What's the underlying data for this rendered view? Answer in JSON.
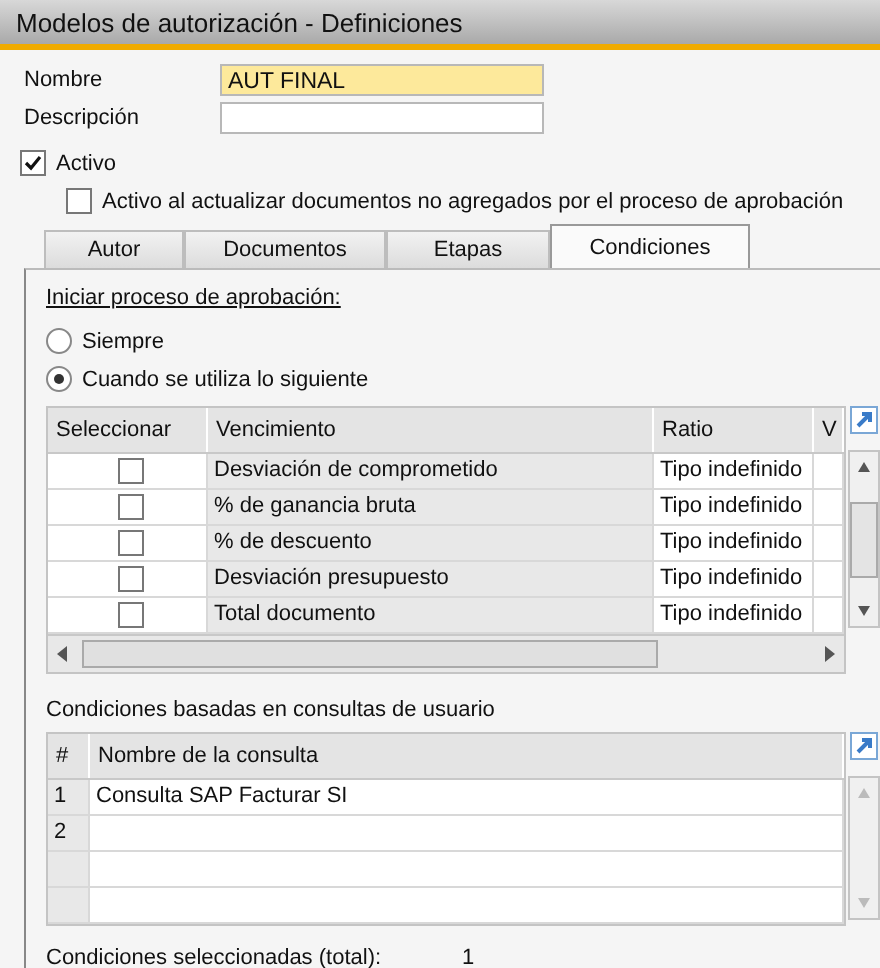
{
  "window": {
    "title": "Modelos de autorización - Definiciones"
  },
  "fields": [
    {
      "label": "Nombre",
      "value": "AUT FINAL",
      "highlighted": true
    },
    {
      "label": "Descripción",
      "highlighted": false
    }
  ],
  "checkboxes": [
    {
      "label": "Activo",
      "checked": true,
      "indented": false
    },
    {
      "label": "Activo al actualizar documentos no agregados por el proceso de aprobación",
      "checked": false,
      "indented": true
    }
  ],
  "tabs": [
    {
      "label": "Autor",
      "selected": false
    },
    {
      "label": "Documentos",
      "selected": false
    },
    {
      "label": "Etapas",
      "selected": false
    },
    {
      "label": "Condiciones",
      "selected": true
    }
  ],
  "conditions": {
    "heading": "Iniciar proceso de aprobación:",
    "radios": [
      {
        "label": "Siempre",
        "selected": false
      },
      {
        "label": "Cuando se utiliza lo siguiente",
        "selected": true
      }
    ],
    "table": {
      "columns": [
        "Seleccionar",
        "Vencimiento",
        "Ratio",
        "V"
      ],
      "rows": [
        {
          "checked": false,
          "name": "Desviación de comprometido",
          "ratio": "Tipo indefinido"
        },
        {
          "checked": false,
          "name": "% de ganancia bruta",
          "ratio": "Tipo indefinido"
        },
        {
          "checked": false,
          "name": "% de descuento",
          "ratio": "Tipo indefinido"
        },
        {
          "checked": false,
          "name": "Desviación presupuesto",
          "ratio": "Tipo indefinido"
        },
        {
          "checked": false,
          "name": "Total documento",
          "ratio": "Tipo indefinido"
        }
      ]
    }
  },
  "queries": {
    "heading": "Condiciones basadas en consultas de usuario",
    "table": {
      "columns": [
        "#",
        "Nombre de la consulta"
      ],
      "rows": [
        {
          "number": "1",
          "name": "Consulta SAP Facturar SI"
        },
        {
          "number": "2"
        }
      ]
    }
  },
  "total": {
    "label": "Condiciones seleccionadas (total):",
    "value": "1"
  }
}
